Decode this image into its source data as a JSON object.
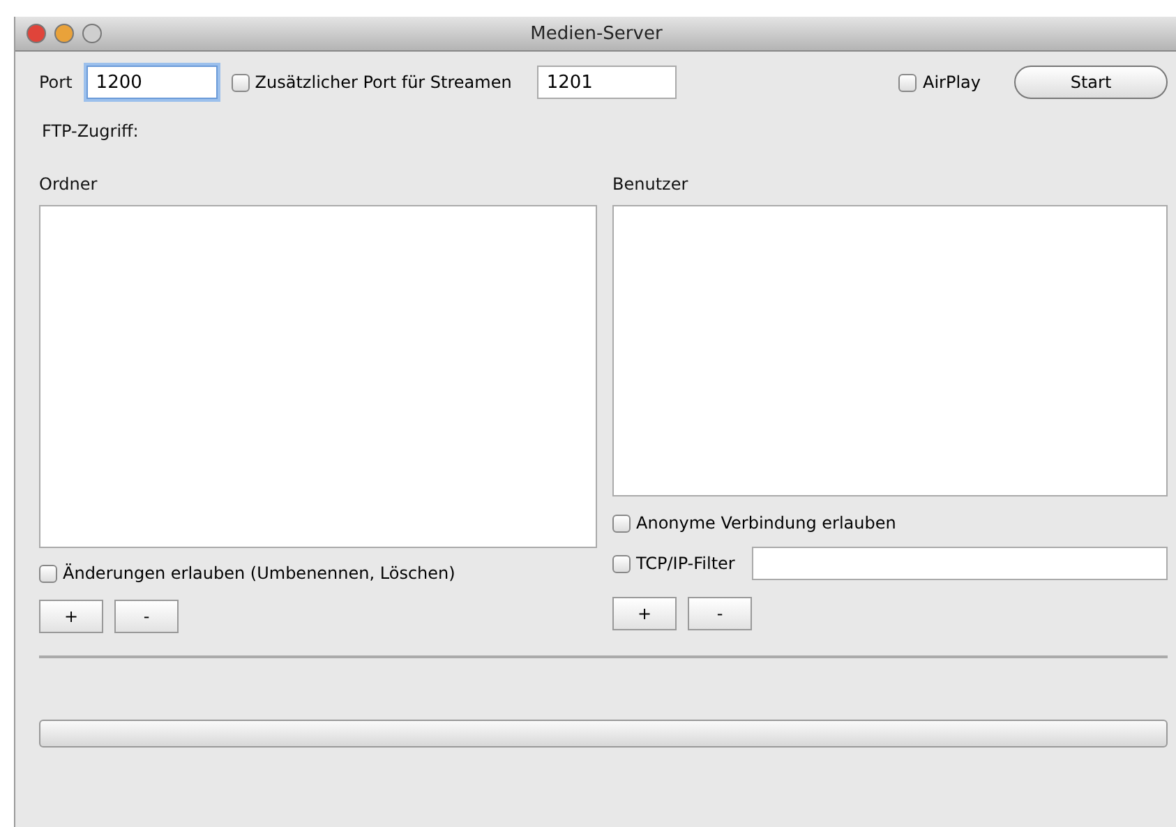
{
  "window": {
    "title": "Medien-Server"
  },
  "server": {
    "port_label": "Port",
    "port": "1200",
    "extra_port": {
      "label": "Zusätzlicher Port für Streamen",
      "checked": false
    },
    "extra_port_value": "1201",
    "airplay": {
      "label": "AirPlay",
      "checked": false
    },
    "start_button": "Start"
  },
  "ftp_label": "FTP-Zugriff:",
  "folders": {
    "title": "Ordner",
    "allow_changes": {
      "label": "Änderungen erlauben (Umbenennen, Löschen)",
      "checked": false
    },
    "buttons": [
      "+",
      "-"
    ]
  },
  "users": {
    "title": "Benutzer",
    "anonymous": {
      "label": "Anonyme Verbindung erlauben",
      "checked": false
    },
    "tcp_filter": {
      "label": "TCP/IP-Filter",
      "checked": false
    },
    "buttons": [
      "+",
      "-"
    ]
  },
  "progress": {
    "level": 0
  }
}
